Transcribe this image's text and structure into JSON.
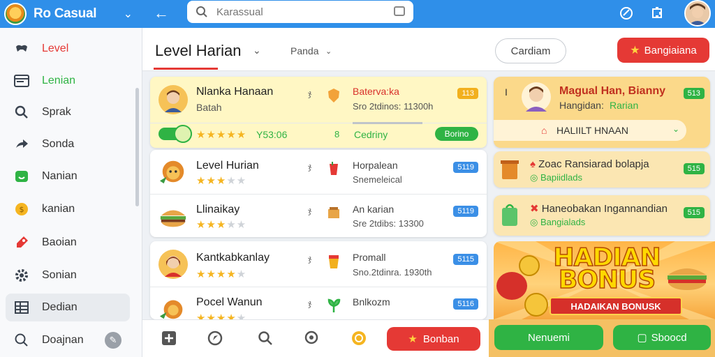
{
  "app": {
    "title": "Ro Casual"
  },
  "search": {
    "placeholder": "Karassual"
  },
  "sidebar": {
    "items": [
      {
        "label": "Level",
        "icon": "gamepad-icon",
        "color": "#e53935"
      },
      {
        "label": "Lenian",
        "icon": "browser-icon",
        "color": "#2fb344"
      },
      {
        "label": "Sprak",
        "icon": "search-refresh-icon",
        "color": "#333333"
      },
      {
        "label": "Sonda",
        "icon": "share-arrow-icon",
        "color": "#333333"
      },
      {
        "label": "Nanian",
        "icon": "smile-box-icon",
        "color": "#333333"
      },
      {
        "label": "kanian",
        "icon": "coin-icon",
        "color": "#333333"
      },
      {
        "label": "Baoian",
        "icon": "pencil-tag-icon",
        "color": "#333333"
      },
      {
        "label": "Sonian",
        "icon": "gear-icon",
        "color": "#333333"
      },
      {
        "label": "Dedian",
        "icon": "grid-icon",
        "color": "#333333"
      },
      {
        "label": "Doajnan",
        "icon": "search-icon",
        "color": "#333333"
      }
    ]
  },
  "header": {
    "title": "Level Harian",
    "filter": "Panda",
    "outline_button": "Cardiam",
    "primary_button": "Bangiaiana"
  },
  "levels": [
    {
      "name": "Nlanka Hanaan",
      "sub": "Batah",
      "x": "ჯ",
      "t1": "Baterva:ka",
      "t2": "Sro 2tdinos: 11300h",
      "badge": "113",
      "extra_rating": "Y53:06",
      "status": "Cedriny",
      "action": "Borino"
    },
    {
      "name": "Level Hurian",
      "stars": 3,
      "x": "ჯ",
      "t1": "Horpalean",
      "t2": "Snemeleical",
      "badge": "5119"
    },
    {
      "name": "Llinaikay",
      "stars": 3,
      "x": "ჯ",
      "t1": "An karian",
      "t2": "Sre 2tdibs: 13300",
      "badge": "5119"
    },
    {
      "name": "Kantkabkanlay",
      "stars": 4,
      "x": "ჯ",
      "t1": "Promall",
      "t2": "Sno.2tdinra. 1930th",
      "badge": "5115"
    },
    {
      "name": "Pocel Wanun",
      "stars": 4,
      "x": "ჯ",
      "t1": "Bnlkozm",
      "t2": "",
      "badge": "5116"
    }
  ],
  "right": {
    "featured": {
      "name": "Magual Han, Bianny",
      "sub_label": "Hangidan:",
      "sub_value": "Rarian",
      "badge": "513",
      "dropdown": "HALIILT HNAAN"
    },
    "tasks": [
      {
        "title": "Zoac Ransiarad bolapja",
        "sub": "Bapiidlads",
        "badge": "515"
      },
      {
        "title": "Haneobakan Ingannandian",
        "sub": "Bangialads",
        "badge": "515"
      }
    ],
    "banner": {
      "title": "HADIAN BONUS",
      "ribbon": "HADAIKAN BONUSK"
    }
  },
  "bottom": {
    "red_button": "Bonban",
    "green_button_1": "Nenuemi",
    "green_button_2": "Sboocd"
  },
  "colors": {
    "topbar": "#2f8fe9",
    "accent_red": "#e53935",
    "accent_green": "#2fb344",
    "badge_blue": "#3b8fe6",
    "star": "#f5b521"
  }
}
